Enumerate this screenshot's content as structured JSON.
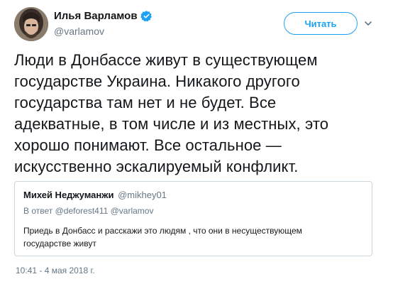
{
  "author": {
    "name": "Илья Варламов",
    "handle": "@varlamov",
    "verified": true
  },
  "follow_button": {
    "label": "Читать"
  },
  "tweet": {
    "lines": [
      "Люди в Донбассе живут в существующем",
      "государстве Украина. Никакого другого",
      "государства там нет и не будет. Все",
      "адекватные, в том числе и из местных, это",
      "хорошо понимают. Все остальное —",
      "искусственно эскалируемый конфликт."
    ],
    "timestamp": "10:41 - 4 мая 2018 г."
  },
  "quoted_tweet": {
    "name": "Михей Неджуманжи",
    "handle": "@mikhey01",
    "reply_prefix": "В ответ",
    "reply_to": "@deforest411 @varlamov",
    "lines": [
      "Приедь в Донбасс и расскажи это людям , что они в несуществующем",
      "государстве живут"
    ]
  },
  "colors": {
    "accent": "#1da1f2",
    "text": "#14171a",
    "secondary": "#657786",
    "border": "#ccd6dd"
  },
  "icons": [
    "verified-badge-icon",
    "chevron-down-icon"
  ]
}
